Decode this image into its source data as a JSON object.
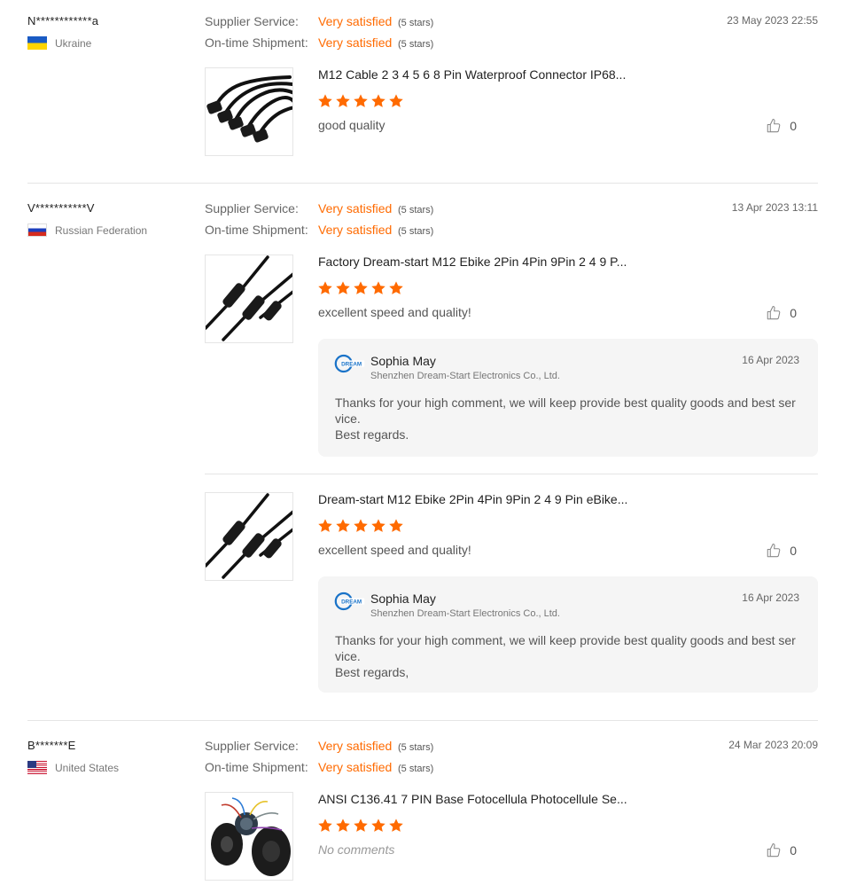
{
  "labels": {
    "supplier_service": "Supplier Service:",
    "ontime_shipment": "On-time Shipment:",
    "satisfied": "Very satisfied",
    "stars_text": "(5 stars)"
  },
  "colors": {
    "accent": "#ff6a00",
    "divider": "#e5e5e5",
    "reply_bg": "#f5f5f5"
  },
  "icons": {
    "like": "thumbs-up-icon",
    "star": "star-icon"
  },
  "reviews": [
    {
      "name": "N************a",
      "country": "Ukraine",
      "flag": "flag-ukraine",
      "date": "23 May 2023 22:55",
      "products": [
        {
          "title": "M12 Cable 2 3 4 5 6 8 Pin Waterproof Connector IP68...",
          "rating": 5,
          "comment": "good quality",
          "likes": "0"
        }
      ]
    },
    {
      "name": "V***********V",
      "country": "Russian Federation",
      "flag": "flag-russia",
      "date": "13 Apr 2023 13:11",
      "products": [
        {
          "title": "Factory Dream-start M12 Ebike 2Pin 4Pin 9Pin 2 4 9 P...",
          "rating": 5,
          "comment": "excellent speed and quality!",
          "likes": "0",
          "reply": {
            "name": "Sophia May",
            "company": "Shenzhen Dream-Start Electronics Co., Ltd.",
            "date": "16 Apr 2023",
            "text1": "Thanks for your high comment, we will keep provide best quality goods and best service.",
            "text2": "Best regards."
          }
        },
        {
          "title": "Dream-start M12 Ebike 2Pin 4Pin 9Pin 2 4 9 Pin eBike...",
          "rating": 5,
          "comment": "excellent speed and quality!",
          "likes": "0",
          "reply": {
            "name": "Sophia May",
            "company": "Shenzhen Dream-Start Electronics Co., Ltd.",
            "date": "16 Apr 2023",
            "text1": "Thanks for your high comment, we will keep provide best quality goods and best service.",
            "text2": "Best regards,"
          }
        }
      ]
    },
    {
      "name": "B*******E",
      "country": "United States",
      "flag": "flag-usa",
      "date": "24 Mar 2023 20:09",
      "products": [
        {
          "title": "ANSI C136.41 7 PIN Base Fotocellula Photocellule Se...",
          "rating": 5,
          "comment": "No comments",
          "likes": "0"
        }
      ]
    }
  ]
}
